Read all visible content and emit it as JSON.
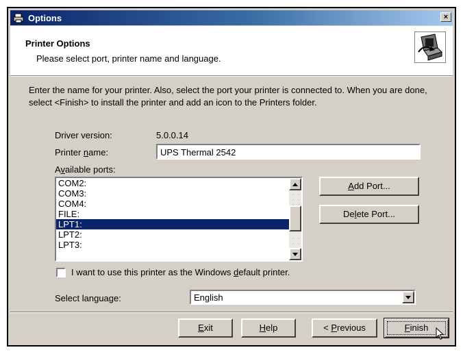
{
  "window": {
    "title": "Options",
    "close_glyph": "×"
  },
  "header": {
    "title": "Printer Options",
    "subtitle": "Please select port, printer name and language.",
    "icon": "printer-install-icon"
  },
  "intro_text": "Enter the name for your printer. Also, select the port your printer is connected to. When you are done, select <Finish> to install the printer and add an icon to the Printers folder.",
  "driver": {
    "label": "Driver version:",
    "value": "5.0.0.14"
  },
  "printer_name": {
    "label_pre": "Printer ",
    "label_key": "n",
    "label_post": "ame:",
    "value": "UPS Thermal 2542"
  },
  "ports": {
    "label_pre": "A",
    "label_key": "v",
    "label_post": "ailable ports:",
    "items": [
      "COM2:",
      "COM3:",
      "COM4:",
      "FILE:",
      "LPT1:",
      "LPT2:",
      "LPT3:"
    ],
    "selected": "LPT1:"
  },
  "port_buttons": {
    "add": {
      "pre": "",
      "key": "A",
      "post": "dd Port..."
    },
    "delete": {
      "pre": "De",
      "key": "l",
      "post": "ete Port..."
    }
  },
  "default_printer": {
    "pre": "I want to use this printer as the Windows ",
    "key": "d",
    "post": "efault printer.",
    "checked": false
  },
  "language": {
    "label": "Select language:",
    "value": "English"
  },
  "footer": {
    "exit": {
      "pre": "",
      "key": "E",
      "post": "xit"
    },
    "help": {
      "pre": "",
      "key": "H",
      "post": "elp"
    },
    "previous": {
      "pre": "< ",
      "key": "P",
      "post": "revious"
    },
    "finish": {
      "pre": "",
      "key": "F",
      "post": "inish"
    }
  },
  "colors": {
    "title_bar": "#0a246a",
    "selection": "#0a246a",
    "face": "#d4d0c8"
  }
}
